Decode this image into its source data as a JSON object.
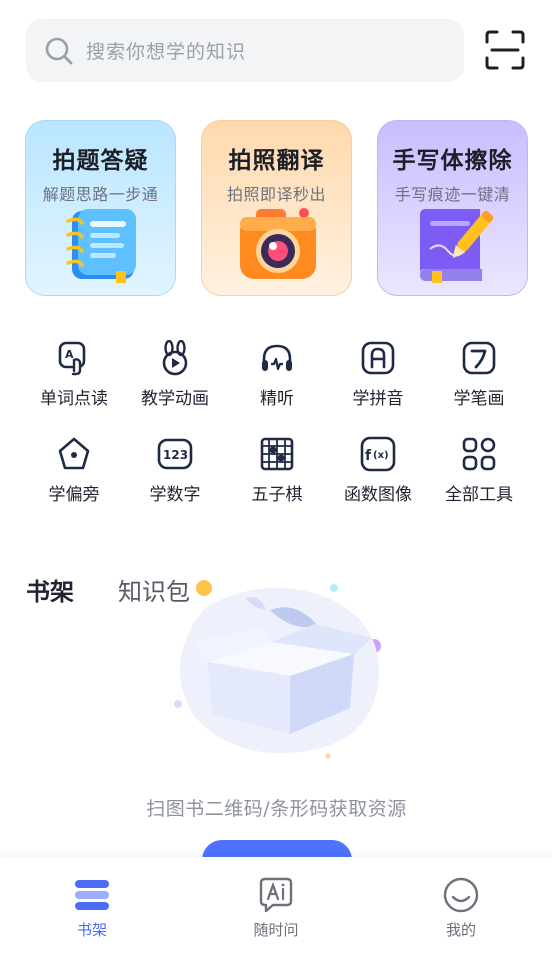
{
  "search": {
    "placeholder": "搜索你想学的知识",
    "icon": "search-icon",
    "scan_icon": "scan-icon"
  },
  "feature_cards": [
    {
      "title": "拍题答疑",
      "subtitle": "解题思路一步通",
      "icon": "notebook-icon",
      "color": "#b9e6ff"
    },
    {
      "title": "拍照翻译",
      "subtitle": "拍照即译秒出",
      "icon": "camera-icon",
      "color": "#ffd9ad"
    },
    {
      "title": "手写体擦除",
      "subtitle": "手写痕迹一键清",
      "icon": "book-pen-icon",
      "color": "#cabdff"
    }
  ],
  "tools": [
    {
      "label": "单词点读",
      "icon": "word-read-icon"
    },
    {
      "label": "教学动画",
      "icon": "animation-icon"
    },
    {
      "label": "精听",
      "icon": "headphone-icon"
    },
    {
      "label": "学拼音",
      "icon": "pinyin-icon"
    },
    {
      "label": "学笔画",
      "icon": "stroke-icon"
    },
    {
      "label": "学偏旁",
      "icon": "radical-icon"
    },
    {
      "label": "学数字",
      "icon": "number-icon"
    },
    {
      "label": "五子棋",
      "icon": "gomoku-icon"
    },
    {
      "label": "函数图像",
      "icon": "function-icon"
    },
    {
      "label": "全部工具",
      "icon": "all-tools-icon"
    }
  ],
  "shelf": {
    "tab_active": "书架",
    "tab_inactive": "知识包",
    "empty_text": "扫图书二维码/条形码获取资源",
    "accent": "#4f73ff"
  },
  "bottom_nav": [
    {
      "label": "书架",
      "icon": "bookshelf-icon",
      "active": true
    },
    {
      "label": "随时问",
      "icon": "ai-chat-icon",
      "active": false
    },
    {
      "label": "我的",
      "icon": "profile-smile-icon",
      "active": false
    }
  ],
  "colors": {
    "primary": "#4a6cf7",
    "icon_navy": "#1f2a44"
  }
}
